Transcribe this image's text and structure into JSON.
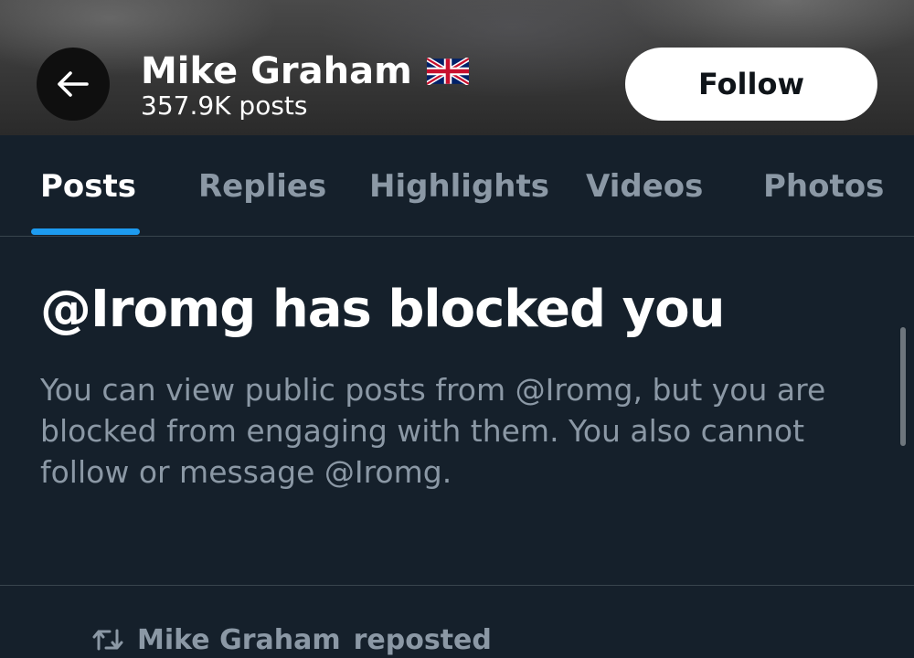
{
  "header": {
    "back_icon": "arrow-left-icon",
    "profile_name": "Mike Graham",
    "flag_icon": "uk-flag-icon",
    "post_count": "357.9K posts",
    "follow_label": "Follow"
  },
  "tabs": [
    {
      "label": "Posts",
      "active": true
    },
    {
      "label": "Replies",
      "active": false
    },
    {
      "label": "Highlights",
      "active": false
    },
    {
      "label": "Videos",
      "active": false
    },
    {
      "label": "Photos",
      "active": false
    }
  ],
  "blocked": {
    "title": "@Iromg has blocked you",
    "body": "You can view public posts from @Iromg, but you are blocked from engaging with them. You also cannot follow or message @Iromg."
  },
  "repost": {
    "icon": "repost-icon",
    "name": "Mike Graham",
    "action": "reposted"
  },
  "colors": {
    "background": "#15202b",
    "accent": "#1d9bf0",
    "muted_text": "#8b98a5",
    "divider": "#38444d"
  }
}
